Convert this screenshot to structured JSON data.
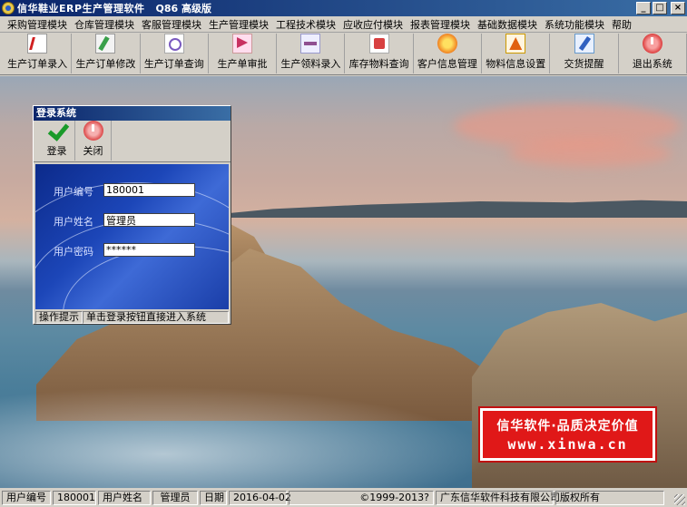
{
  "window": {
    "title": "信华鞋业ERP生产管理软件",
    "version": "Q86 高级版",
    "controls": [
      "_",
      "□",
      "×"
    ]
  },
  "menu": [
    "采购管理模块",
    "仓库管理模块",
    "客服管理模块",
    "生产管理模块",
    "工程技术模块",
    "应收应付模块",
    "报表管理模块",
    "基础数据模块",
    "系统功能模块",
    "帮助"
  ],
  "toolbar": [
    {
      "label": "生产订单录入",
      "icon": "doc-icon"
    },
    {
      "label": "生产订单修改",
      "icon": "edit-icon"
    },
    {
      "label": "生产订单查询",
      "icon": "query-icon"
    },
    {
      "label": "生产单审批",
      "icon": "approve-icon"
    },
    {
      "label": "生产领料录入",
      "icon": "pick-icon"
    },
    {
      "label": "库存物料查询",
      "icon": "stock-icon"
    },
    {
      "label": "客户信息管理",
      "icon": "customer-icon"
    },
    {
      "label": "物料信息设置",
      "icon": "material-icon"
    },
    {
      "label": "交货提醒",
      "icon": "delivery-icon"
    },
    {
      "label": "退出系统",
      "icon": "exit-icon"
    }
  ],
  "login": {
    "title": "登录系统",
    "login_label": "登录",
    "close_label": "关闭",
    "user_id_label": "用户编号",
    "user_id_value": "180001",
    "user_name_label": "用户姓名",
    "user_name_value": "管理员",
    "password_label": "用户密码",
    "password_value": "******",
    "hint_label": "操作提示",
    "hint_text": "单击登录按钮直接进入系统"
  },
  "watermark": {
    "line1": "信华软件·品质决定价值",
    "line2": "www.xinwa.cn"
  },
  "statusbar": {
    "user_id_label": "用户编号",
    "user_id": "180001",
    "user_name_label": "用户姓名",
    "user_name": "管理员",
    "date_label": "日期",
    "date": "2016-04-02",
    "copyright": "©1999-2013?",
    "company": "广东信华软件科技有限公司",
    "rights": "版权所有"
  }
}
